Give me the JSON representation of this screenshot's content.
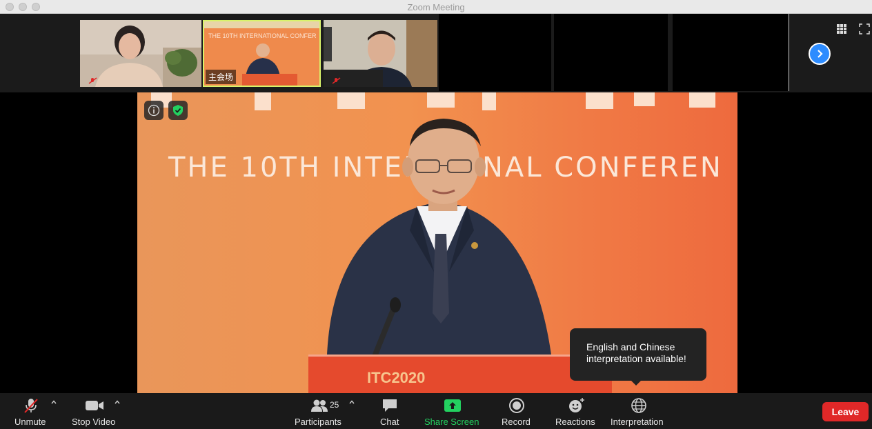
{
  "window": {
    "title": "Zoom Meeting"
  },
  "thumbnails": [
    {
      "name": "",
      "pinned_label": ""
    },
    {
      "name": "主会场"
    },
    {
      "name": ""
    }
  ],
  "thumb_conference_text": "THE 10TH INTERNATIONAL CONFER",
  "stage": {
    "banner_text": "THE 10TH INTERN   ONAL CONFEREN",
    "podium_text": "ITC2020"
  },
  "tooltip": {
    "line1": "English and Chinese",
    "line2": "interpretation available!"
  },
  "toolbar": {
    "unmute": "Unmute",
    "stop_video": "Stop Video",
    "participants": "Participants",
    "participant_count": "25",
    "chat": "Chat",
    "share_screen": "Share Screen",
    "record": "Record",
    "reactions": "Reactions",
    "interpretation": "Interpretation",
    "leave": "Leave"
  },
  "colors": {
    "share_green": "#23d160",
    "leave_red": "#e02828",
    "active_border": "#d8f26a",
    "accent_blue": "#2d8cff"
  }
}
